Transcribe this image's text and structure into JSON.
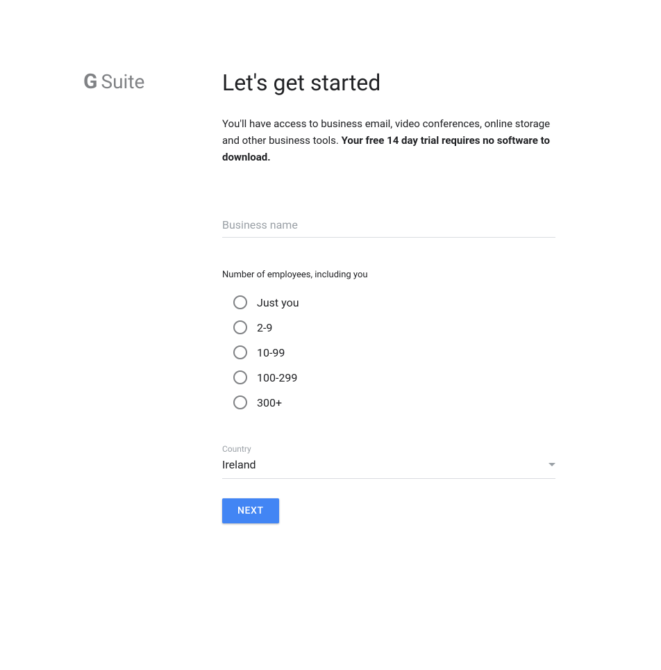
{
  "brand": {
    "g": "G",
    "suite": "Suite"
  },
  "page": {
    "title": "Let's get started",
    "intro_plain": "You'll have access to business email, video conferences, online storage and other business tools. ",
    "intro_bold": "Your free 14 day trial requires no software to download."
  },
  "form": {
    "business_name": {
      "placeholder": "Business name",
      "value": ""
    },
    "employees": {
      "label": "Number of employees, including you",
      "options": [
        {
          "label": "Just you"
        },
        {
          "label": "2-9"
        },
        {
          "label": "10-99"
        },
        {
          "label": "100-299"
        },
        {
          "label": "300+"
        }
      ]
    },
    "country": {
      "label": "Country",
      "value": "Ireland"
    },
    "next_label": "NEXT"
  }
}
